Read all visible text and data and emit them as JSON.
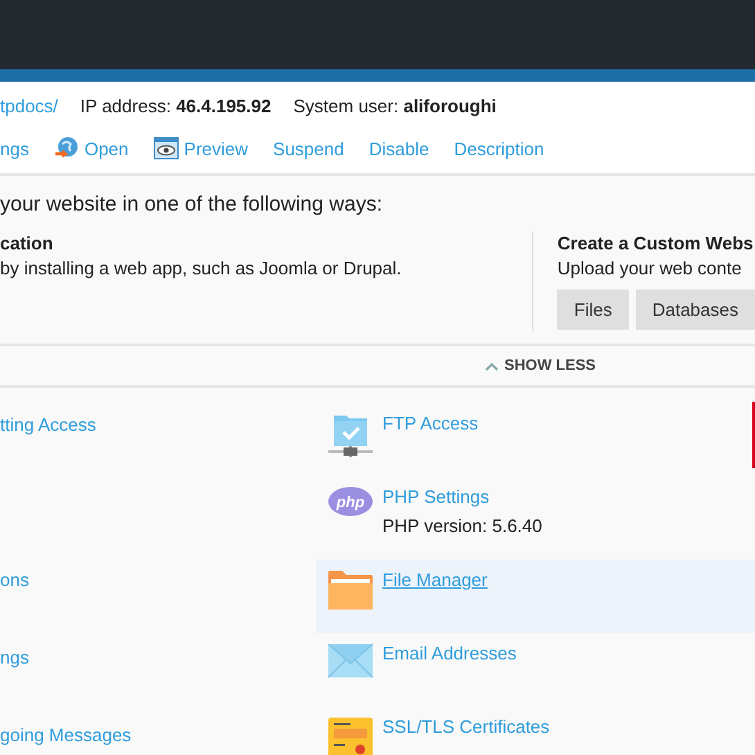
{
  "header": {
    "path": "tpdocs/",
    "ip_label": "IP address:",
    "ip": "46.4.195.92",
    "user_label": "System user:",
    "user": "aliforoughi"
  },
  "actions": [
    {
      "kind": "text",
      "label": "ngs"
    },
    {
      "kind": "open",
      "label": "Open"
    },
    {
      "kind": "preview",
      "label": "Preview"
    },
    {
      "kind": "text",
      "label": "Suspend"
    },
    {
      "kind": "text",
      "label": "Disable"
    },
    {
      "kind": "text",
      "label": "Description"
    }
  ],
  "intro": "your website in one of the following ways:",
  "app_card": {
    "title": "cation",
    "text": "by installing a web app, such as Joomla or Drupal."
  },
  "custom_card": {
    "title": "Create a Custom Webs",
    "text": "Upload your web conte",
    "buttons": [
      "Files",
      "Databases"
    ]
  },
  "toggle": {
    "label": "SHOW LESS",
    "expanded": true
  },
  "left_items": [
    {
      "label": "tting Access"
    },
    {
      "label": "ons"
    },
    {
      "label": "ngs"
    },
    {
      "label": "going Messages"
    }
  ],
  "right_items": [
    {
      "kind": "ftp",
      "label": "FTP Access",
      "selected": false
    },
    {
      "kind": "php",
      "label": "PHP Settings",
      "note": "PHP version: 5.6.40",
      "selected": false
    },
    {
      "kind": "folder",
      "label": "File Manager",
      "selected": true
    },
    {
      "kind": "mail",
      "label": "Email Addresses",
      "selected": false
    },
    {
      "kind": "cert",
      "label": "SSL/TLS Certificates",
      "selected": false
    }
  ]
}
